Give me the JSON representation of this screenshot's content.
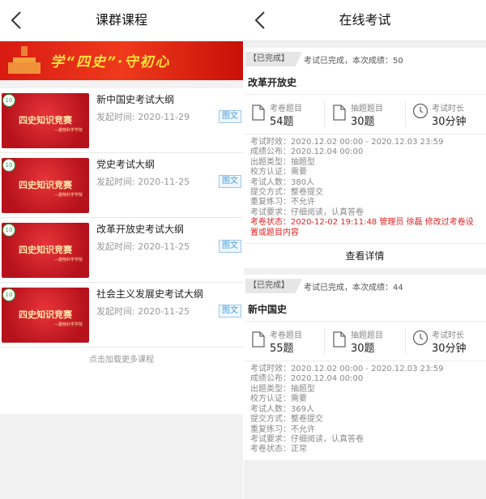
{
  "left": {
    "title": "课群课程",
    "banner_text": "学“四史”·守初心",
    "courses": [
      {
        "title": "新中国史考试大纲",
        "date": "发起时间: 2020-11-29",
        "tag": "图文",
        "thumb_title": "四史知识竞赛",
        "thumb_sub": "—趣物科学学院",
        "badge": "10"
      },
      {
        "title": "党史考试大纲",
        "date": "发起时间: 2020-11-25",
        "tag": "图文",
        "thumb_title": "四史知识竞赛",
        "thumb_sub": "—趣物科学学院",
        "badge": "10"
      },
      {
        "title": "改革开放史考试大纲",
        "date": "发起时间: 2020-11-25",
        "tag": "图文",
        "thumb_title": "四史知识竞赛",
        "thumb_sub": "—趣物科学学院",
        "badge": "10"
      },
      {
        "title": "社会主义发展史考试大纲",
        "date": "发起时间: 2020-11-25",
        "tag": "图文",
        "thumb_title": "四史知识竞赛",
        "thumb_sub": "—趣物科学学院",
        "badge": "10"
      }
    ],
    "load_more": "点击加载更多课程"
  },
  "right": {
    "title": "在线考试",
    "exams": [
      {
        "status_tag": "【已完成】",
        "status_text": "考试已完成，本次成绩：50",
        "name": "改革开放史",
        "stats": [
          {
            "label": "考卷题目",
            "value": "54题",
            "icon": "document-icon"
          },
          {
            "label": "抽题题目",
            "value": "30题",
            "icon": "document-icon"
          },
          {
            "label": "考试时长",
            "value": "30分钟",
            "icon": "clock-icon"
          }
        ],
        "info": [
          {
            "k": "考试时效：",
            "v": "2020.12.02 00:00 - 2020.12.03 23:59"
          },
          {
            "k": "成绩公布：",
            "v": "2020.12.04 00:00"
          },
          {
            "k": "出题类型：",
            "v": "抽题型"
          },
          {
            "k": "校方认证：",
            "v": "需要"
          },
          {
            "k": "考试人数：",
            "v": "380人"
          },
          {
            "k": "提交方式：",
            "v": "整卷提交"
          },
          {
            "k": "重复练习：",
            "v": "不允许"
          },
          {
            "k": "考试要求：",
            "v": "仔细阅读，认真答卷"
          }
        ],
        "state_label": "考卷状态：",
        "state_value": "2020-12-02 19:11:48 管理员 徐磊 修改过考卷设置或题目内容",
        "state_red": true,
        "detail": "查看详情"
      },
      {
        "status_tag": "【已完成】",
        "status_text": "考试已完成，本次成绩：44",
        "name": "新中国史",
        "stats": [
          {
            "label": "考卷题目",
            "value": "55题",
            "icon": "document-icon"
          },
          {
            "label": "抽题题目",
            "value": "30题",
            "icon": "document-icon"
          },
          {
            "label": "考试时长",
            "value": "30分钟",
            "icon": "clock-icon"
          }
        ],
        "info": [
          {
            "k": "考试时效：",
            "v": "2020.12.02 00:00 - 2020.12.03 23:59"
          },
          {
            "k": "成绩公布：",
            "v": "2020.12.04 00:00"
          },
          {
            "k": "出题类型：",
            "v": "抽题型"
          },
          {
            "k": "校方认证：",
            "v": "需要"
          },
          {
            "k": "考试人数：",
            "v": "369人"
          },
          {
            "k": "提交方式：",
            "v": "整卷提交"
          },
          {
            "k": "重复练习：",
            "v": "不允许"
          },
          {
            "k": "考试要求：",
            "v": "仔细阅读，认真答卷"
          }
        ],
        "state_label": "考卷状态：",
        "state_value": "正常",
        "state_red": false,
        "detail": ""
      }
    ]
  }
}
